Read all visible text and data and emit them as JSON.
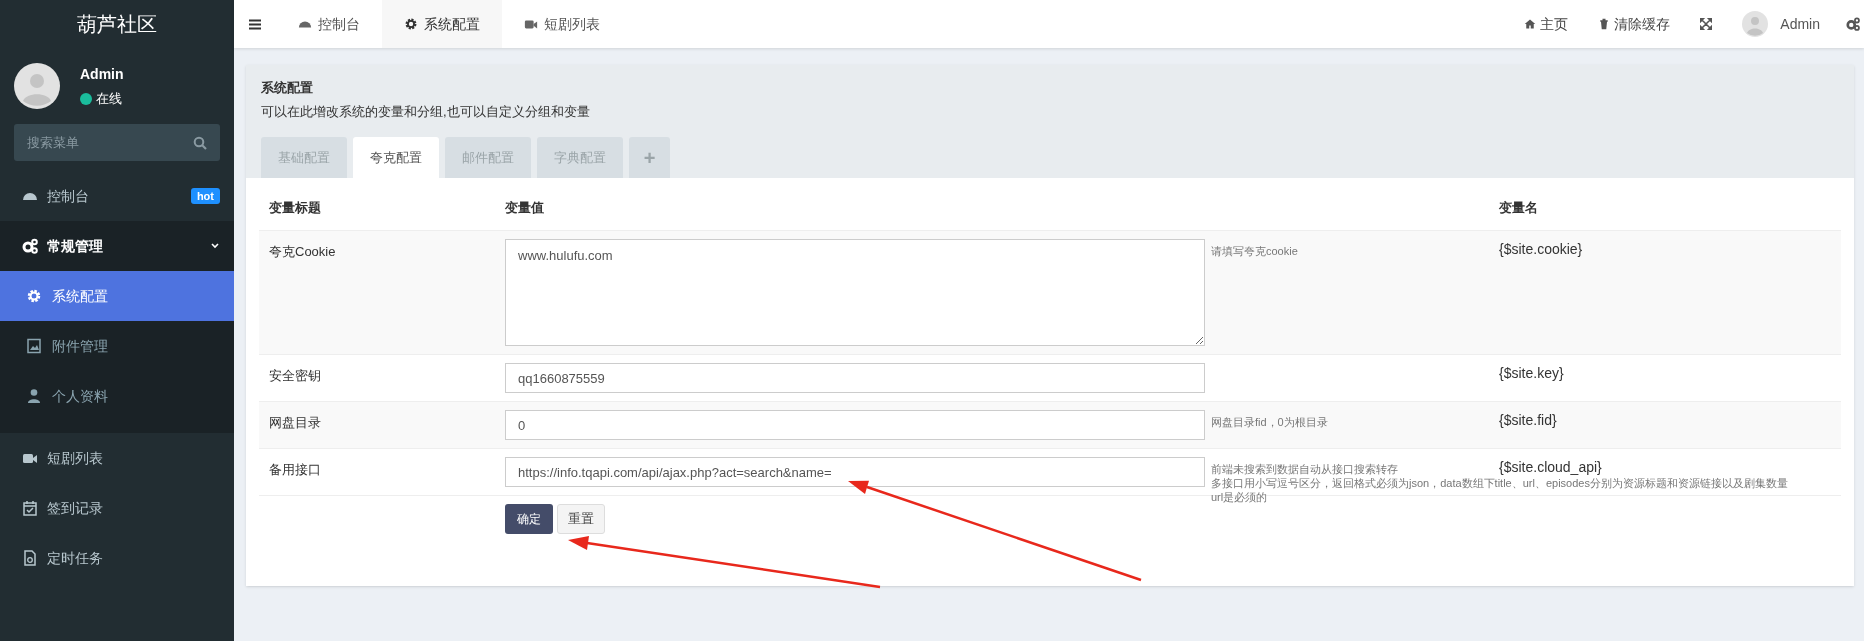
{
  "sidebar": {
    "logo": "葫芦社区",
    "user": {
      "name": "Admin",
      "status": "在线"
    },
    "search": {
      "placeholder": "搜索菜单"
    },
    "menu": [
      {
        "label": "控制台",
        "badge": "hot",
        "selected": false
      },
      {
        "label": "常规管理",
        "selected": false,
        "expanded": true,
        "children": [
          {
            "label": "系统配置",
            "selected": true
          },
          {
            "label": "附件管理",
            "selected": false
          },
          {
            "label": "个人资料",
            "selected": false
          }
        ]
      },
      {
        "label": "短剧列表",
        "selected": false
      },
      {
        "label": "签到记录",
        "selected": false
      },
      {
        "label": "定时任务",
        "selected": false
      }
    ]
  },
  "top_bar": {
    "tabs": [
      {
        "label": "控制台",
        "selected": false
      },
      {
        "label": "系统配置",
        "selected": true
      },
      {
        "label": "短剧列表",
        "selected": false
      }
    ],
    "links": [
      "主页",
      "清除缓存"
    ],
    "user": {
      "name": "Admin"
    }
  },
  "panel": {
    "title": "系统配置",
    "description": "可以在此增改系统的变量和分组,也可以自定义分组和变量",
    "tabs": [
      {
        "label": "基础配置",
        "selected": false
      },
      {
        "label": "夸克配置",
        "selected": true
      },
      {
        "label": "邮件配置",
        "selected": false
      },
      {
        "label": "字典配置",
        "selected": false
      }
    ],
    "add_tab": "+",
    "table": {
      "columns": [
        "变量标题",
        "变量值",
        "变量名"
      ],
      "rows": [
        {
          "title": "夸克Cookie",
          "kind": "textarea",
          "value": "www.hulufu.com",
          "hint": [
            "请填写夸克cookie"
          ],
          "variable": "{$site.cookie}"
        },
        {
          "title": "安全密钥",
          "kind": "input",
          "value": "qq1660875559",
          "variable": "{$site.key}"
        },
        {
          "title": "网盘目录",
          "kind": "input",
          "value": "0",
          "hint": [
            "网盘目录fid，0为根目录"
          ],
          "variable": "{$site.fid}"
        },
        {
          "title": "备用接口",
          "kind": "input",
          "value": "https://info.tqapi.com/api/ajax.php?act=search&name=",
          "hint": [
            "前端未搜索到数据自动从接口搜索转存",
            "多接口用小写逗号区分，返回格式必须为json，data数组下title、url、episodes分别为资源标题和资源链接以及剧集数量",
            "url是必须的"
          ],
          "variable": "{$site.cloud_api}"
        }
      ]
    },
    "buttons": [
      "确定",
      "重置"
    ]
  }
}
